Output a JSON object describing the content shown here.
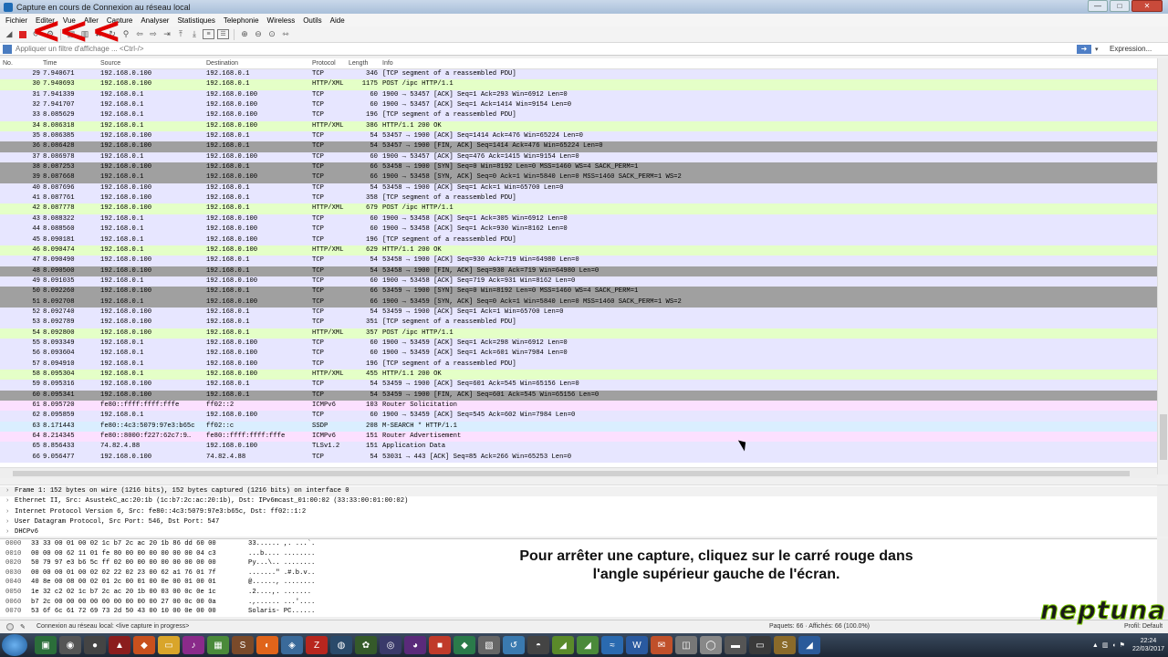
{
  "window": {
    "title": "Capture en cours de Connexion au réseau local"
  },
  "menu": [
    "Fichier",
    "Editer",
    "Vue",
    "Aller",
    "Capture",
    "Analyser",
    "Statistiques",
    "Telephonie",
    "Wireless",
    "Outils",
    "Aide"
  ],
  "filter": {
    "placeholder": "Appliquer un filtre d'affichage ... <Ctrl-/>",
    "expression_label": "Expression..."
  },
  "columns": [
    "No.",
    "Time",
    "Source",
    "Destination",
    "Protocol",
    "Length",
    "Info"
  ],
  "packets": [
    {
      "no": "29",
      "time": "7.940671",
      "src": "192.168.0.100",
      "dst": "192.168.0.1",
      "proto": "TCP",
      "len": "346",
      "info": "[TCP segment of a reassembled PDU]",
      "type": "tcp"
    },
    {
      "no": "30",
      "time": "7.940693",
      "src": "192.168.0.100",
      "dst": "192.168.0.1",
      "proto": "HTTP/XML",
      "len": "1175",
      "info": "POST /ipc HTTP/1.1",
      "type": "http"
    },
    {
      "no": "31",
      "time": "7.941339",
      "src": "192.168.0.1",
      "dst": "192.168.0.100",
      "proto": "TCP",
      "len": "60",
      "info": "1900 → 53457 [ACK] Seq=1 Ack=293 Win=6912 Len=0",
      "type": "tcp"
    },
    {
      "no": "32",
      "time": "7.941707",
      "src": "192.168.0.1",
      "dst": "192.168.0.100",
      "proto": "TCP",
      "len": "60",
      "info": "1900 → 53457 [ACK] Seq=1 Ack=1414 Win=9154 Len=0",
      "type": "tcp"
    },
    {
      "no": "33",
      "time": "8.085629",
      "src": "192.168.0.1",
      "dst": "192.168.0.100",
      "proto": "TCP",
      "len": "196",
      "info": "[TCP segment of a reassembled PDU]",
      "type": "tcp"
    },
    {
      "no": "34",
      "time": "8.086318",
      "src": "192.168.0.1",
      "dst": "192.168.0.100",
      "proto": "HTTP/XML",
      "len": "386",
      "info": "HTTP/1.1 200 OK",
      "type": "http"
    },
    {
      "no": "35",
      "time": "8.086385",
      "src": "192.168.0.100",
      "dst": "192.168.0.1",
      "proto": "TCP",
      "len": "54",
      "info": "53457 → 1900 [ACK] Seq=1414 Ack=476 Win=65224 Len=0",
      "type": "tcp"
    },
    {
      "no": "36",
      "time": "8.086428",
      "src": "192.168.0.100",
      "dst": "192.168.0.1",
      "proto": "TCP",
      "len": "54",
      "info": "53457 → 1900 [FIN, ACK] Seq=1414 Ack=476 Win=65224 Len=0",
      "type": "dark"
    },
    {
      "no": "37",
      "time": "8.086978",
      "src": "192.168.0.1",
      "dst": "192.168.0.100",
      "proto": "TCP",
      "len": "60",
      "info": "1900 → 53457 [ACK] Seq=476 Ack=1415 Win=9154 Len=0",
      "type": "tcp"
    },
    {
      "no": "38",
      "time": "8.087253",
      "src": "192.168.0.100",
      "dst": "192.168.0.1",
      "proto": "TCP",
      "len": "66",
      "info": "53458 → 1900 [SYN] Seq=0 Win=8192 Len=0 MSS=1460 WS=4 SACK_PERM=1",
      "type": "dark"
    },
    {
      "no": "39",
      "time": "8.087668",
      "src": "192.168.0.1",
      "dst": "192.168.0.100",
      "proto": "TCP",
      "len": "66",
      "info": "1900 → 53458 [SYN, ACK] Seq=0 Ack=1 Win=5840 Len=0 MSS=1460 SACK_PERM=1 WS=2",
      "type": "dark"
    },
    {
      "no": "40",
      "time": "8.087696",
      "src": "192.168.0.100",
      "dst": "192.168.0.1",
      "proto": "TCP",
      "len": "54",
      "info": "53458 → 1900 [ACK] Seq=1 Ack=1 Win=65700 Len=0",
      "type": "tcp"
    },
    {
      "no": "41",
      "time": "8.087761",
      "src": "192.168.0.100",
      "dst": "192.168.0.1",
      "proto": "TCP",
      "len": "358",
      "info": "[TCP segment of a reassembled PDU]",
      "type": "tcp"
    },
    {
      "no": "42",
      "time": "8.087778",
      "src": "192.168.0.100",
      "dst": "192.168.0.1",
      "proto": "HTTP/XML",
      "len": "679",
      "info": "POST /ipc HTTP/1.1",
      "type": "http"
    },
    {
      "no": "43",
      "time": "8.088322",
      "src": "192.168.0.1",
      "dst": "192.168.0.100",
      "proto": "TCP",
      "len": "60",
      "info": "1900 → 53458 [ACK] Seq=1 Ack=305 Win=6912 Len=0",
      "type": "tcp"
    },
    {
      "no": "44",
      "time": "8.088560",
      "src": "192.168.0.1",
      "dst": "192.168.0.100",
      "proto": "TCP",
      "len": "60",
      "info": "1900 → 53458 [ACK] Seq=1 Ack=930 Win=8162 Len=0",
      "type": "tcp"
    },
    {
      "no": "45",
      "time": "8.090181",
      "src": "192.168.0.1",
      "dst": "192.168.0.100",
      "proto": "TCP",
      "len": "196",
      "info": "[TCP segment of a reassembled PDU]",
      "type": "tcp"
    },
    {
      "no": "46",
      "time": "8.090474",
      "src": "192.168.0.1",
      "dst": "192.168.0.100",
      "proto": "HTTP/XML",
      "len": "629",
      "info": "HTTP/1.1 200 OK",
      "type": "http"
    },
    {
      "no": "47",
      "time": "8.090490",
      "src": "192.168.0.100",
      "dst": "192.168.0.1",
      "proto": "TCP",
      "len": "54",
      "info": "53458 → 1900 [ACK] Seq=930 Ack=719 Win=64980 Len=0",
      "type": "tcp"
    },
    {
      "no": "48",
      "time": "8.090500",
      "src": "192.168.0.100",
      "dst": "192.168.0.1",
      "proto": "TCP",
      "len": "54",
      "info": "53458 → 1900 [FIN, ACK] Seq=930 Ack=719 Win=64980 Len=0",
      "type": "dark"
    },
    {
      "no": "49",
      "time": "8.091035",
      "src": "192.168.0.1",
      "dst": "192.168.0.100",
      "proto": "TCP",
      "len": "60",
      "info": "1900 → 53458 [ACK] Seq=719 Ack=931 Win=8162 Len=0",
      "type": "tcp"
    },
    {
      "no": "50",
      "time": "8.092260",
      "src": "192.168.0.100",
      "dst": "192.168.0.1",
      "proto": "TCP",
      "len": "66",
      "info": "53459 → 1900 [SYN] Seq=0 Win=8192 Len=0 MSS=1460 WS=4 SACK_PERM=1",
      "type": "dark"
    },
    {
      "no": "51",
      "time": "8.092708",
      "src": "192.168.0.1",
      "dst": "192.168.0.100",
      "proto": "TCP",
      "len": "66",
      "info": "1900 → 53459 [SYN, ACK] Seq=0 Ack=1 Win=5840 Len=0 MSS=1460 SACK_PERM=1 WS=2",
      "type": "dark"
    },
    {
      "no": "52",
      "time": "8.092740",
      "src": "192.168.0.100",
      "dst": "192.168.0.1",
      "proto": "TCP",
      "len": "54",
      "info": "53459 → 1900 [ACK] Seq=1 Ack=1 Win=65700 Len=0",
      "type": "tcp"
    },
    {
      "no": "53",
      "time": "8.092789",
      "src": "192.168.0.100",
      "dst": "192.168.0.1",
      "proto": "TCP",
      "len": "351",
      "info": "[TCP segment of a reassembled PDU]",
      "type": "tcp"
    },
    {
      "no": "54",
      "time": "8.092800",
      "src": "192.168.0.100",
      "dst": "192.168.0.1",
      "proto": "HTTP/XML",
      "len": "357",
      "info": "POST /ipc HTTP/1.1",
      "type": "http"
    },
    {
      "no": "55",
      "time": "8.093349",
      "src": "192.168.0.1",
      "dst": "192.168.0.100",
      "proto": "TCP",
      "len": "60",
      "info": "1900 → 53459 [ACK] Seq=1 Ack=298 Win=6912 Len=0",
      "type": "tcp"
    },
    {
      "no": "56",
      "time": "8.093604",
      "src": "192.168.0.1",
      "dst": "192.168.0.100",
      "proto": "TCP",
      "len": "60",
      "info": "1900 → 53459 [ACK] Seq=1 Ack=601 Win=7984 Len=0",
      "type": "tcp"
    },
    {
      "no": "57",
      "time": "8.094910",
      "src": "192.168.0.1",
      "dst": "192.168.0.100",
      "proto": "TCP",
      "len": "196",
      "info": "[TCP segment of a reassembled PDU]",
      "type": "tcp"
    },
    {
      "no": "58",
      "time": "8.095304",
      "src": "192.168.0.1",
      "dst": "192.168.0.100",
      "proto": "HTTP/XML",
      "len": "455",
      "info": "HTTP/1.1 200 OK",
      "type": "http"
    },
    {
      "no": "59",
      "time": "8.095316",
      "src": "192.168.0.100",
      "dst": "192.168.0.1",
      "proto": "TCP",
      "len": "54",
      "info": "53459 → 1900 [ACK] Seq=601 Ack=545 Win=65156 Len=0",
      "type": "tcp"
    },
    {
      "no": "60",
      "time": "8.095341",
      "src": "192.168.0.100",
      "dst": "192.168.0.1",
      "proto": "TCP",
      "len": "54",
      "info": "53459 → 1900 [FIN, ACK] Seq=601 Ack=545 Win=65156 Len=0",
      "type": "dark"
    },
    {
      "no": "61",
      "time": "8.095720",
      "src": "fe80::ffff:ffff:fffe",
      "dst": "ff02::2",
      "proto": "ICMPv6",
      "len": "103",
      "info": "Router Solicitation",
      "type": "icmp"
    },
    {
      "no": "62",
      "time": "8.095859",
      "src": "192.168.0.1",
      "dst": "192.168.0.100",
      "proto": "TCP",
      "len": "60",
      "info": "1900 → 53459 [ACK] Seq=545 Ack=602 Win=7984 Len=0",
      "type": "tcp"
    },
    {
      "no": "63",
      "time": "8.171443",
      "src": "fe80::4c3:5079:97e3:b65c",
      "dst": "ff02::c",
      "proto": "SSDP",
      "len": "208",
      "info": "M-SEARCH * HTTP/1.1",
      "type": "ssdp"
    },
    {
      "no": "64",
      "time": "8.214345",
      "src": "fe80::8000:f227:62c7:9…",
      "dst": "fe80::ffff:ffff:fffe",
      "proto": "ICMPv6",
      "len": "151",
      "info": "Router Advertisement",
      "type": "icmp"
    },
    {
      "no": "65",
      "time": "8.856433",
      "src": "74.82.4.88",
      "dst": "192.168.0.100",
      "proto": "TLSv1.2",
      "len": "151",
      "info": "Application Data",
      "type": "tls"
    },
    {
      "no": "66",
      "time": "9.056477",
      "src": "192.168.0.100",
      "dst": "74.82.4.88",
      "proto": "TCP",
      "len": "54",
      "info": "53031 → 443 [ACK] Seq=85 Ack=266 Win=65253 Len=0",
      "type": "tcp"
    }
  ],
  "details": [
    "Frame 1: 152 bytes on wire (1216 bits), 152 bytes captured (1216 bits) on interface 0",
    "Ethernet II, Src: AsustekC_ac:20:1b (1c:b7:2c:ac:20:1b), Dst: IPv6mcast_01:00:02 (33:33:00:01:00:02)",
    "Internet Protocol Version 6, Src: fe80::4c3:5079:97e3:b65c, Dst: ff02::1:2",
    "User Datagram Protocol, Src Port: 546, Dst Port: 547",
    "DHCPv6"
  ],
  "bytes": [
    {
      "off": "0000",
      "hex": "33 33 00 01 00 02 1c b7  2c ac 20 1b 86 dd 60 00",
      "ascii": "33...... ,. ...`."
    },
    {
      "off": "0010",
      "hex": "00 00 00 62 11 01 fe 80  00 00 00 00 00 00 04 c3",
      "ascii": "...b.... ........"
    },
    {
      "off": "0020",
      "hex": "50 79 97 e3 b6 5c ff 02  00 00 00 00 00 00 00 00",
      "ascii": "Py...\\.. ........"
    },
    {
      "off": "0030",
      "hex": "00 00 00 01 00 02 02 22  02 23 00 62 a1 76 01 7f",
      "ascii": ".......\" .#.b.v.."
    },
    {
      "off": "0040",
      "hex": "40 8e 00 08 00 02 01 2c  00 01 00 0e 00 01 00 01",
      "ascii": "@......, ........"
    },
    {
      "off": "0050",
      "hex": "1e 32 c2 02 1c b7 2c ac  20 1b 00 03 00 0c 0e 1c",
      "ascii": ".2....,. .......  "
    },
    {
      "off": "0060",
      "hex": "b7 2c 00 00 00 00 00 00  00 00 00 27 00 0c 00 0a",
      "ascii": ".,...... ...'...."
    },
    {
      "off": "0070",
      "hex": "53 6f 6c 61 72 69 73 2d  50 43 00 10 00 0e 00 00",
      "ascii": "Solaris- PC......"
    }
  ],
  "caption": [
    "Pour arrêter une capture, cliquez sur le carré rouge dans",
    "l'angle supérieur gauche de l'écran."
  ],
  "status": {
    "interface": "Connexion au réseau local: <live capture in progress>",
    "packets": "Paquets: 66 · Affichés: 66 (100.0%)",
    "profile": "Profil: Default"
  },
  "logo": "neptuna",
  "clock": {
    "time": "22:24",
    "date": "22/03/2017"
  },
  "colors": {
    "tcp": "#e7e6ff",
    "http": "#e4ffc7",
    "dark": "#a0a0a0",
    "icmp": "#fce0ff",
    "ssdp": "#daeeff",
    "stop": "#dd2222"
  }
}
